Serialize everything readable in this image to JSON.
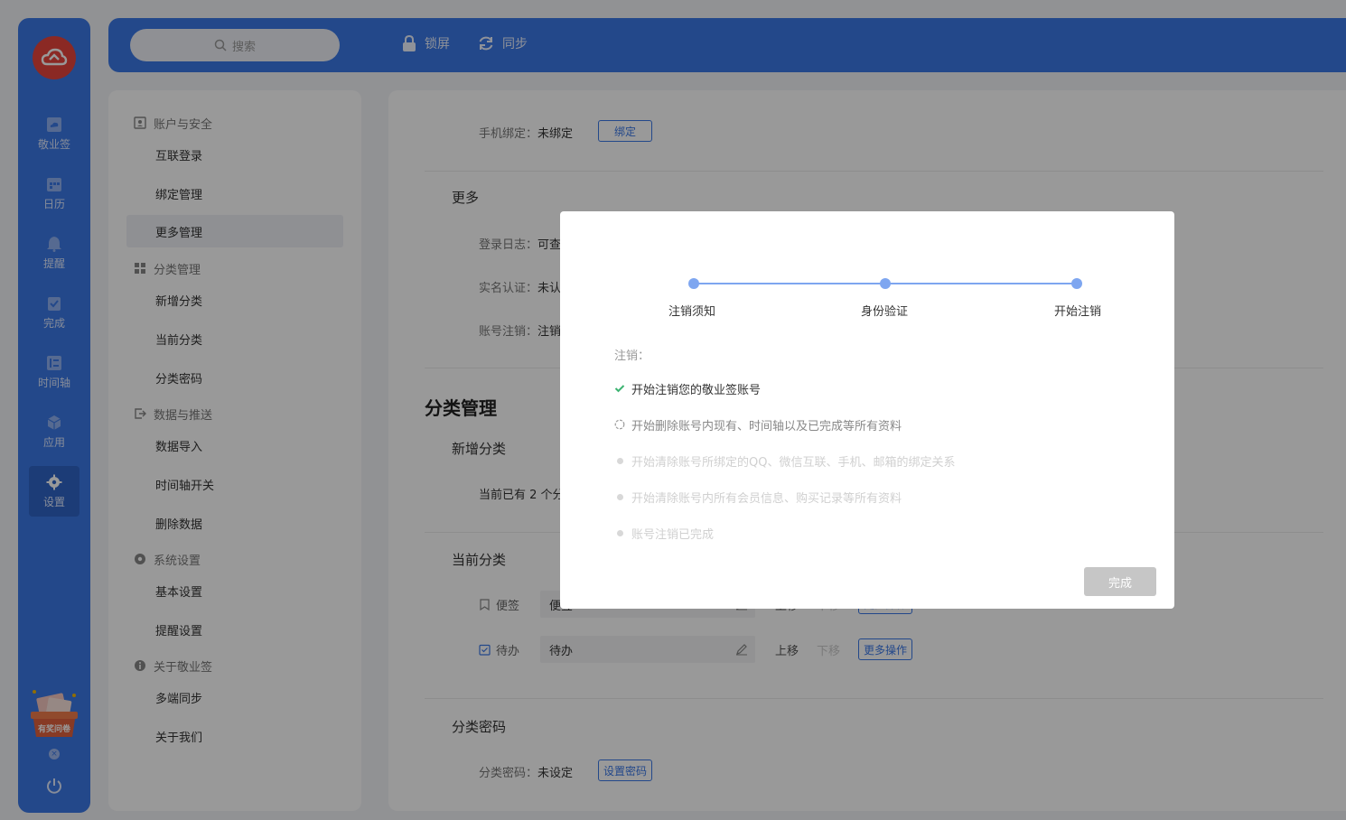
{
  "colors": {
    "primary": "#3b78e6",
    "logo": "#e8453c",
    "check": "#3cb371"
  },
  "sidebar": {
    "items": [
      {
        "label": "敬业签",
        "icon": "note-icon"
      },
      {
        "label": "日历",
        "icon": "calendar-icon"
      },
      {
        "label": "提醒",
        "icon": "bell-icon"
      },
      {
        "label": "完成",
        "icon": "done-icon"
      },
      {
        "label": "时间轴",
        "icon": "timeline-icon"
      },
      {
        "label": "应用",
        "icon": "apps-icon"
      },
      {
        "label": "设置",
        "icon": "gear-icon",
        "active": true
      }
    ],
    "promo_text": "有奖问卷",
    "close_glyph": "×"
  },
  "topbar": {
    "search_placeholder": "搜索",
    "lock_label": "锁屏",
    "sync_label": "同步"
  },
  "menu": {
    "groups": [
      {
        "title": "账户与安全",
        "icon": "account-icon",
        "items": [
          "互联登录",
          "绑定管理",
          "更多管理"
        ]
      },
      {
        "title": "分类管理",
        "icon": "category-icon",
        "items": [
          "新增分类",
          "当前分类",
          "分类密码"
        ]
      },
      {
        "title": "数据与推送",
        "icon": "export-icon",
        "items": [
          "数据导入",
          "时间轴开关",
          "删除数据"
        ]
      },
      {
        "title": "系统设置",
        "icon": "settings-icon",
        "items": [
          "基本设置",
          "提醒设置"
        ]
      },
      {
        "title": "关于敬业签",
        "icon": "info-icon",
        "items": [
          "多端同步",
          "关于我们"
        ]
      }
    ],
    "selected": "更多管理"
  },
  "content": {
    "phone_label": "手机绑定：",
    "phone_value": "未绑定",
    "phone_button": "绑定",
    "more_heading": "更多",
    "login_log_label": "登录日志：",
    "login_log_value": "可查",
    "realname_label": "实名认证：",
    "realname_value": "未认",
    "cancel_label": "账号注销：",
    "cancel_value": "注销",
    "category_title": "分类管理",
    "add_heading": "新增分类",
    "add_text": "当前已有 2 个分",
    "current_heading": "当前分类",
    "categories": [
      {
        "name": "便签",
        "value": "便签",
        "up": "上移",
        "down": "下移",
        "more": "更多操作"
      },
      {
        "name": "待办",
        "value": "待办",
        "up": "上移",
        "down": "下移",
        "more": "更多操作"
      }
    ],
    "pwd_heading": "分类密码",
    "pwd_label": "分类密码：",
    "pwd_value": "未设定",
    "pwd_button": "设置密码"
  },
  "modal": {
    "steps": [
      "注销须知",
      "身份验证",
      "开始注销"
    ],
    "title": "注销：",
    "progress": [
      {
        "text": "开始注销您的敬业签账号",
        "state": "done"
      },
      {
        "text": "开始删除账号内现有、时间轴以及已完成等所有资料",
        "state": "doing"
      },
      {
        "text": "开始清除账号所绑定的QQ、微信互联、手机、邮箱的绑定关系",
        "state": "todo"
      },
      {
        "text": "开始清除账号内所有会员信息、购买记录等所有资料",
        "state": "todo"
      },
      {
        "text": "账号注销已完成",
        "state": "todo"
      }
    ],
    "finish_button": "完成"
  }
}
